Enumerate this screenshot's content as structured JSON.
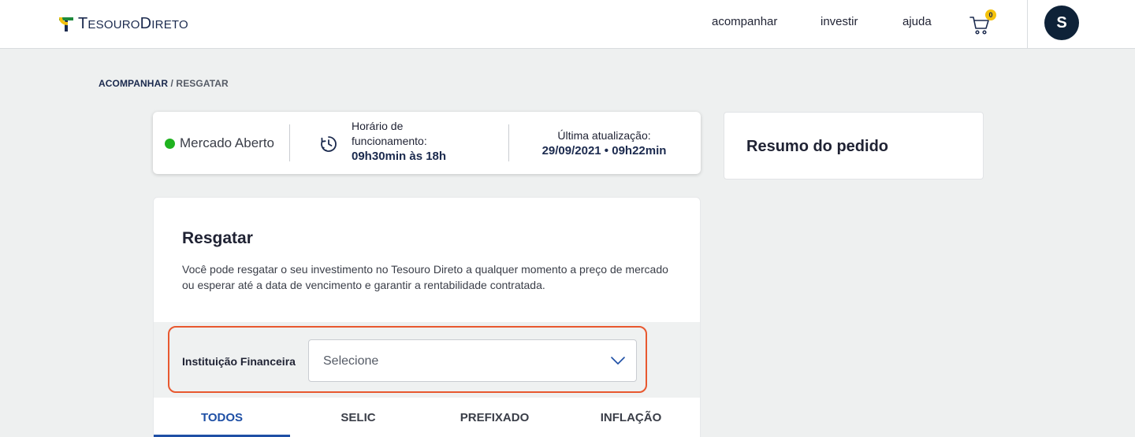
{
  "header": {
    "logo_text_T": "T",
    "logo_text_esouro": "ESOURO",
    "logo_text_D": "D",
    "logo_text_ireto": "IRETO",
    "nav": [
      "acompanhar",
      "investir",
      "ajuda"
    ],
    "cart_count": "0",
    "avatar_initial": "S"
  },
  "breadcrumb": {
    "parent": "ACOMPANHAR",
    "separator": "/",
    "current": "RESGATAR"
  },
  "market": {
    "status": "Mercado Aberto",
    "hours_label_line1": "Horário de",
    "hours_label_line2": "funcionamento:",
    "hours_value": "09h30min às 18h",
    "update_label": "Última atualização:",
    "update_value": "29/09/2021 • 09h22min",
    "status_color": "#1fb31f"
  },
  "summary": {
    "title": "Resumo do pedido"
  },
  "main": {
    "title": "Resgatar",
    "description": "Você pode resgatar o seu investimento no Tesouro Direto a qualquer momento a preço de mercado ou esperar até a data de vencimento e garantir a rentabilidade contratada.",
    "filter_label": "Instituição Financeira",
    "select_value": "Selecione",
    "tabs": [
      {
        "label": "TODOS",
        "active": true
      },
      {
        "label": "SELIC",
        "active": false
      },
      {
        "label": "PREFIXADO",
        "active": false
      },
      {
        "label": "INFLAÇÃO",
        "active": false
      }
    ]
  },
  "colors": {
    "brand_navy": "#1b2a4e",
    "accent_blue": "#1e4fa5",
    "highlight_orange": "#e8582f",
    "badge_yellow": "#f4c20d"
  }
}
